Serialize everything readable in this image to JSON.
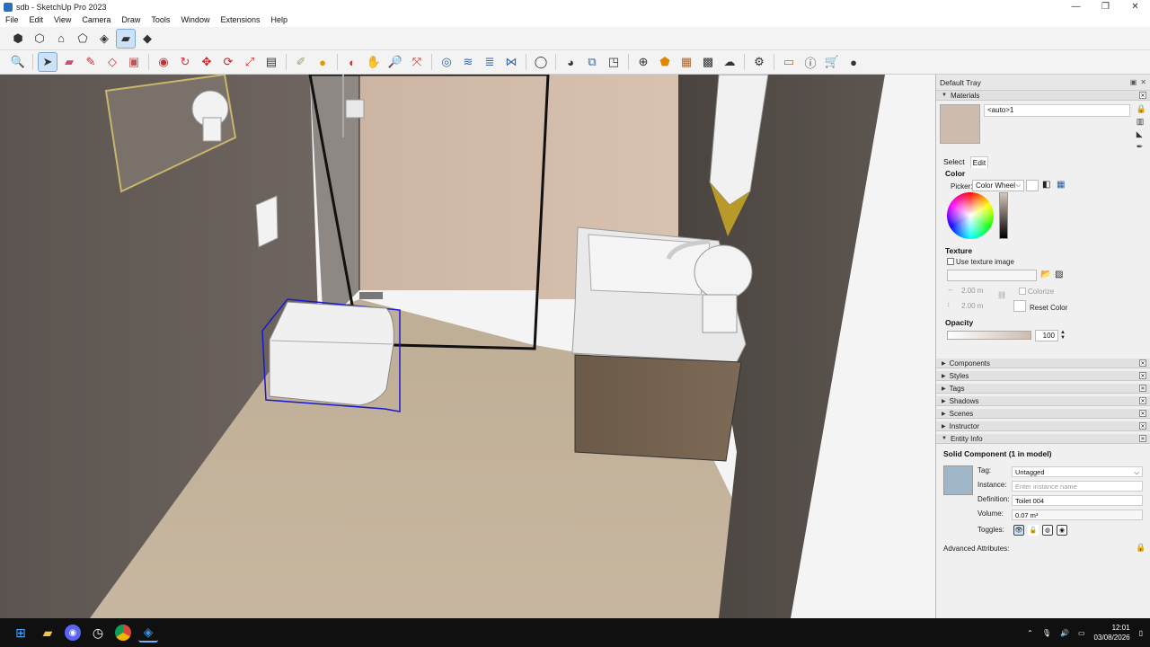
{
  "window": {
    "title": "sdb - SketchUp Pro 2023",
    "minimize": "—",
    "maximize": "❐",
    "close": "✕"
  },
  "menu": [
    "File",
    "Edit",
    "View",
    "Camera",
    "Draw",
    "Tools",
    "Window",
    "Extensions",
    "Help"
  ],
  "toolbar1": [
    "iso-view",
    "top-view",
    "front-view",
    "right-view",
    "back-view",
    "left-view",
    "bottom-view"
  ],
  "toolbar2": [
    "zoom",
    "select",
    "eraser",
    "pencil",
    "shapes",
    "push-pull",
    "move",
    "rotate",
    "scale",
    "offset",
    "tape",
    "paint",
    "orbit",
    "pan",
    "zoom-window",
    "zoom-extents",
    "sandbox-1",
    "sandbox-2",
    "sandbox-3",
    "sandbox-4",
    "user",
    "solid-1",
    "solid-2",
    "solid-3",
    "add",
    "warehouse",
    "extension",
    "trimble",
    "cloud",
    "settings",
    "layout",
    "info",
    "cart",
    "account"
  ],
  "tray": {
    "title": "Default Tray",
    "materials": {
      "header": "Materials",
      "name": "<auto>1",
      "tab_select": "Select",
      "tab_edit": "Edit",
      "color_label": "Color",
      "picker_label": "Picker:",
      "picker_value": "Color Wheel",
      "texture_label": "Texture",
      "use_texture": "Use texture image",
      "width": "2.00 m",
      "height": "2.00 m",
      "colorize": "Colorize",
      "reset_color": "Reset Color",
      "opacity_label": "Opacity",
      "opacity_value": "100"
    },
    "panels": [
      "Components",
      "Styles",
      "Tags",
      "Shadows",
      "Scenes",
      "Instructor",
      "Entity Info"
    ],
    "entity_info": {
      "title": "Solid Component (1 in model)",
      "tag_label": "Tag:",
      "tag_value": "Untagged",
      "instance_label": "Instance:",
      "instance_placeholder": "Enter instance name",
      "definition_label": "Definition:",
      "definition_value": "Toilet 004",
      "volume_label": "Volume:",
      "volume_value": "0.07 m³",
      "toggles_label": "Toggles:",
      "advanced": "Advanced Attributes:"
    }
  },
  "taskbar": {
    "time": "12:01",
    "date": "03/08/2026"
  }
}
